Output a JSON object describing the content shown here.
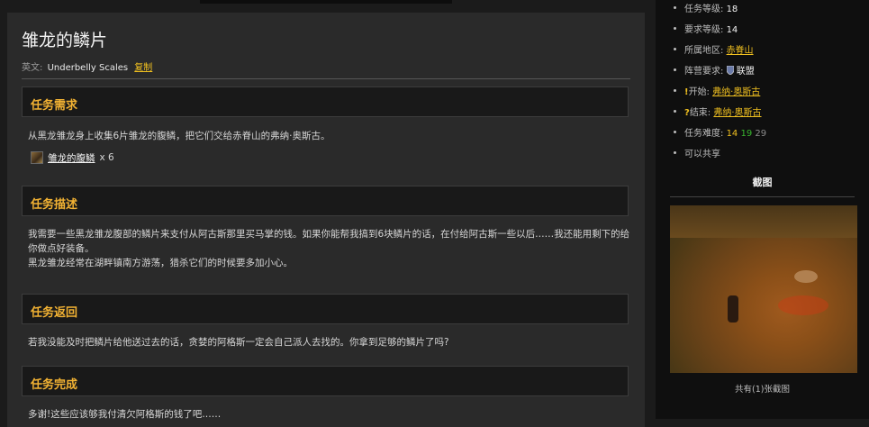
{
  "quest": {
    "title": "雏龙的鳞片",
    "en_label": "英文:",
    "en_name": "Underbelly Scales",
    "copy_label": "复制"
  },
  "sections": {
    "requirements": {
      "heading": "任务需求",
      "text": "从黑龙雏龙身上收集6片雏龙的腹鳞，把它们交给赤脊山的弗纳·奥斯古。",
      "item_name": "雏龙的腹鳞",
      "item_count": "x 6",
      "item_icon": "scale-item-icon"
    },
    "description": {
      "heading": "任务描述",
      "text_1": "我需要一些黑龙雏龙腹部的鳞片来支付从阿古斯那里买马掌的钱。如果你能帮我搞到6块鳞片的话，在付给阿古斯一些以后……我还能用剩下的给你做点好装备。",
      "text_2": "黑龙雏龙经常在湖畔镇南方游荡，猎杀它们的时候要多加小心。"
    },
    "return": {
      "heading": "任务返回",
      "text": "若我没能及时把鳞片给他送过去的话，贪婪的阿格斯一定会自己派人去找的。你拿到足够的鳞片了吗?"
    },
    "complete": {
      "heading": "任务完成",
      "text": "多谢!这些应该够我付清欠阿格斯的钱了吧……"
    }
  },
  "sidebar": {
    "quest_level_label": "任务等级:",
    "quest_level": "18",
    "required_level_label": "要求等级:",
    "required_level": "14",
    "zone_label": "所属地区:",
    "zone": "赤脊山",
    "faction_label": "阵营要求:",
    "faction": "联盟",
    "faction_icon": "alliance-shield-icon",
    "start_label": "开始:",
    "start_npc": "弗纳·奥斯古",
    "end_label": "结束:",
    "end_npc": "弗纳·奥斯古",
    "difficulty_label": "任务难度:",
    "difficulty_yellow": "14",
    "difficulty_green": "19",
    "difficulty_grey": "29",
    "shareable": "可以共享",
    "screenshot_title": "截图",
    "screenshot_caption": "共有(1)张截图",
    "colors": {
      "accent": "#f0c020",
      "heading": "#f2b233",
      "difficulty_green": "#38b42e",
      "difficulty_grey": "#8b8b8b"
    }
  }
}
